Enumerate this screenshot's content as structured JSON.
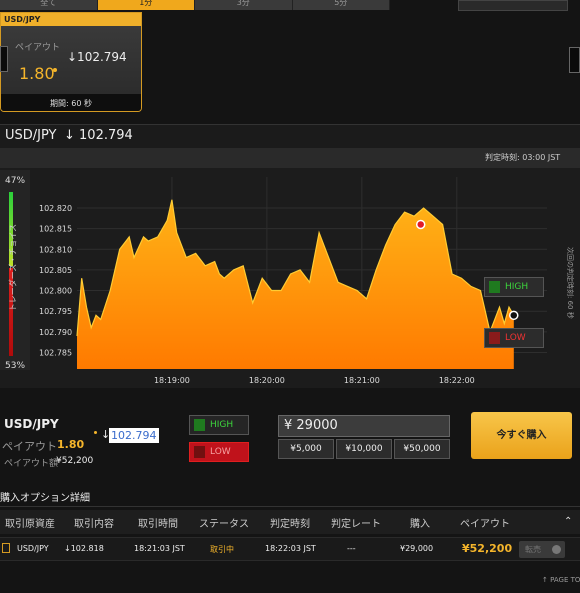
{
  "tabs": [
    "全て",
    "1分",
    "3分",
    "5分"
  ],
  "top_select_value": "",
  "card": {
    "pair": "USD/JPY",
    "payout_label": "ペイアウト",
    "payout_value": "1.80",
    "rate": "↓102.794",
    "period": "期間: 60 秒"
  },
  "chart_header": {
    "pair": "USD/JPY",
    "rate": "↓ 102.794",
    "judge_time": "判定時刻: 03:00 JST"
  },
  "trader_gauge": {
    "top_percent": "47%",
    "bottom_percent": "53%",
    "label": "トレーダーズ・チョイス",
    "high_fraction": 0.47
  },
  "expiry_label": "次回の判定時刻: 60 秒",
  "side_buttons": {
    "high": "HIGH",
    "low": "LOW"
  },
  "chart_data": {
    "type": "area",
    "y_ticks": [
      "102.820",
      "102.815",
      "102.810",
      "102.805",
      "102.800",
      "102.795",
      "102.790",
      "102.785"
    ],
    "x_ticks": [
      "18:19:00",
      "18:20:00",
      "18:21:00",
      "18:22:00"
    ],
    "ylim": [
      102.781,
      102.8275
    ],
    "xlim": [
      0,
      4.95
    ],
    "color_top": "#ffb317",
    "color_bottom": "#ff7a00",
    "x": [
      0,
      0.05,
      0.1,
      0.15,
      0.2,
      0.25,
      0.35,
      0.45,
      0.55,
      0.6,
      0.7,
      0.75,
      0.85,
      0.95,
      1.0,
      1.05,
      1.15,
      1.25,
      1.35,
      1.45,
      1.5,
      1.55,
      1.65,
      1.75,
      1.85,
      1.95,
      2.05,
      2.15,
      2.25,
      2.35,
      2.45,
      2.55,
      2.65,
      2.75,
      2.85,
      2.95,
      3.05,
      3.15,
      3.25,
      3.35,
      3.45,
      3.55,
      3.65,
      3.75,
      3.85,
      3.95,
      4.05,
      4.15,
      4.25,
      4.35,
      4.45,
      4.5,
      4.55,
      4.6
    ],
    "y": [
      102.789,
      102.803,
      102.796,
      102.791,
      102.794,
      102.793,
      102.8,
      102.81,
      102.813,
      102.808,
      102.813,
      102.812,
      102.813,
      102.817,
      102.822,
      102.814,
      102.808,
      102.809,
      102.806,
      102.807,
      102.804,
      102.803,
      102.805,
      102.806,
      102.797,
      102.803,
      102.8,
      102.8,
      102.804,
      102.805,
      102.802,
      102.814,
      102.808,
      102.802,
      102.801,
      102.8,
      102.798,
      102.805,
      102.811,
      102.816,
      102.819,
      102.818,
      102.82,
      102.818,
      102.816,
      102.804,
      102.803,
      102.801,
      102.8,
      102.79,
      102.796,
      102.792,
      102.796,
      102.794
    ],
    "markers": [
      {
        "x": 3.62,
        "y": 102.816,
        "kind": "entry",
        "color": "#e21a2a"
      },
      {
        "x": 4.6,
        "y": 102.794,
        "kind": "current",
        "color": "#ffffff"
      }
    ]
  },
  "trade": {
    "pair": "USD/JPY",
    "payout_label": "ペイアウト",
    "payout_value": "1.80",
    "amount_label": "ペイアウト額",
    "amount_value": "¥52,200",
    "rate_arrow": "↓",
    "rate": "102.794",
    "high_label": "HIGH",
    "low_label": "LOW",
    "input_value": "¥ 29000",
    "amount_buttons": [
      "¥5,000",
      "¥10,000",
      "¥50,000"
    ],
    "buy_label": "今すぐ購入"
  },
  "details": {
    "title": "購入オプション詳細",
    "headers": [
      "取引原資産",
      "取引内容",
      "取引時間",
      "ステータス",
      "判定時刻",
      "判定レート",
      "購入",
      "ペイアウト"
    ],
    "row": {
      "asset": "USD/JPY",
      "content": "↓102.818",
      "time": "18:21:03 JST",
      "status": "取引中",
      "judge_time": "18:22:03 JST",
      "judge_rate": "---",
      "purchase": "¥29,000",
      "payout": "¥52,200",
      "sell_label": "転売"
    }
  },
  "page_top": "↑ PAGE TOP"
}
